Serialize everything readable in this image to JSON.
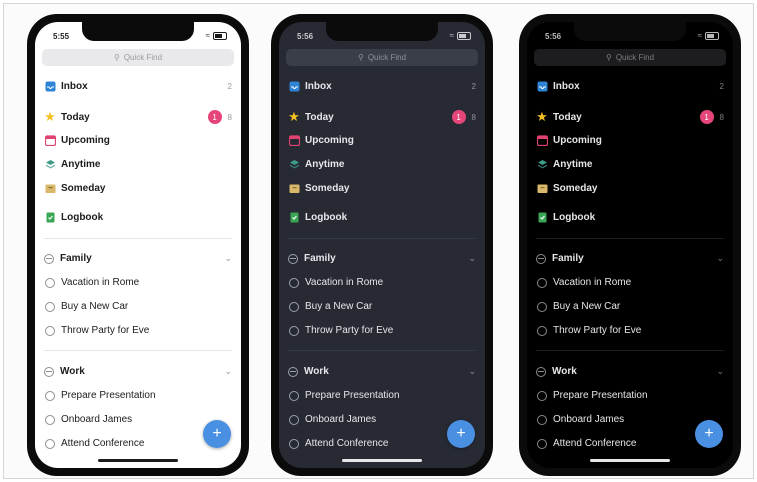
{
  "phones": [
    {
      "theme": "light",
      "time": "5:55",
      "search_placeholder": "Quick Find",
      "lists": [
        {
          "label": "Inbox",
          "icon": "inbox-icon",
          "count": "2"
        },
        {
          "label": "Today",
          "icon": "star-icon",
          "badge": "1",
          "count": "8"
        },
        {
          "label": "Upcoming",
          "icon": "calendar-icon"
        },
        {
          "label": "Anytime",
          "icon": "layers-icon"
        },
        {
          "label": "Someday",
          "icon": "archive-box-icon"
        },
        {
          "label": "Logbook",
          "icon": "logbook-icon"
        }
      ],
      "areas": [
        {
          "label": "Family",
          "projects": [
            "Vacation in Rome",
            "Buy a New Car",
            "Throw Party for Eve"
          ]
        },
        {
          "label": "Work",
          "projects": [
            "Prepare Presentation",
            "Onboard James",
            "Attend Conference"
          ]
        }
      ]
    },
    {
      "theme": "dark",
      "time": "5:56",
      "search_placeholder": "Quick Find",
      "lists": [
        {
          "label": "Inbox",
          "icon": "inbox-icon",
          "count": "2"
        },
        {
          "label": "Today",
          "icon": "star-icon",
          "badge": "1",
          "count": "8"
        },
        {
          "label": "Upcoming",
          "icon": "calendar-icon"
        },
        {
          "label": "Anytime",
          "icon": "layers-icon"
        },
        {
          "label": "Someday",
          "icon": "archive-box-icon"
        },
        {
          "label": "Logbook",
          "icon": "logbook-icon"
        }
      ],
      "areas": [
        {
          "label": "Family",
          "projects": [
            "Vacation in Rome",
            "Buy a New Car",
            "Throw Party for Eve"
          ]
        },
        {
          "label": "Work",
          "projects": [
            "Prepare Presentation",
            "Onboard James",
            "Attend Conference"
          ]
        }
      ]
    },
    {
      "theme": "black",
      "time": "5:56",
      "search_placeholder": "Quick Find",
      "lists": [
        {
          "label": "Inbox",
          "icon": "inbox-icon",
          "count": "2"
        },
        {
          "label": "Today",
          "icon": "star-icon",
          "badge": "1",
          "count": "8"
        },
        {
          "label": "Upcoming",
          "icon": "calendar-icon"
        },
        {
          "label": "Anytime",
          "icon": "layers-icon"
        },
        {
          "label": "Someday",
          "icon": "archive-box-icon"
        },
        {
          "label": "Logbook",
          "icon": "logbook-icon"
        }
      ],
      "areas": [
        {
          "label": "Family",
          "projects": [
            "Vacation in Rome",
            "Buy a New Car",
            "Throw Party for Eve"
          ]
        },
        {
          "label": "Work",
          "projects": [
            "Prepare Presentation",
            "Onboard James",
            "Attend Conference"
          ]
        }
      ]
    }
  ],
  "colors": {
    "badge": "#e6457a",
    "fab": "#4a90e2",
    "inbox_icon": "#2f84d6",
    "today_star": "#f5c024",
    "upcoming_icon": "#e0436f",
    "anytime_icon": "#3d9b8a",
    "someday_icon": "#d9b86c",
    "logbook_icon": "#3aa655"
  }
}
